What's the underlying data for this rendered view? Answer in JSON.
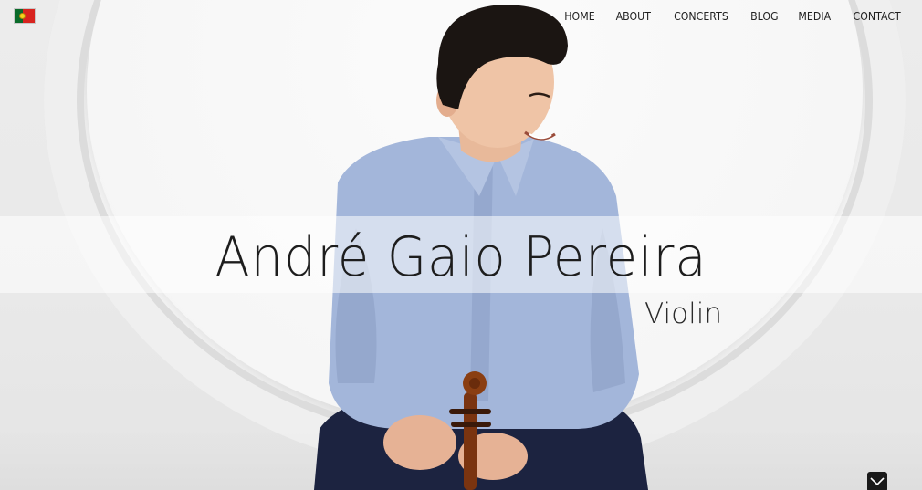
{
  "site": {
    "language_flag": "portugal-flag-icon",
    "nav": {
      "items": [
        {
          "label": "HOME",
          "active": true
        },
        {
          "label": "ABOUT",
          "active": false
        },
        {
          "label": "CONCERTS",
          "active": false
        },
        {
          "label": "BLOG",
          "active": false
        },
        {
          "label": "MEDIA",
          "active": false
        },
        {
          "label": "CONTACT",
          "active": false
        }
      ]
    }
  },
  "hero": {
    "title": "André Gaio Pereira",
    "subtitle": "Violin",
    "scroll_icon": "chevron-down-icon"
  },
  "colors": {
    "text": "#1d1d1d",
    "shirt": "#9fb3d8",
    "trousers": "#1c2340",
    "violin": "#8a3e12",
    "scroll_button": "#1a1a1a"
  }
}
